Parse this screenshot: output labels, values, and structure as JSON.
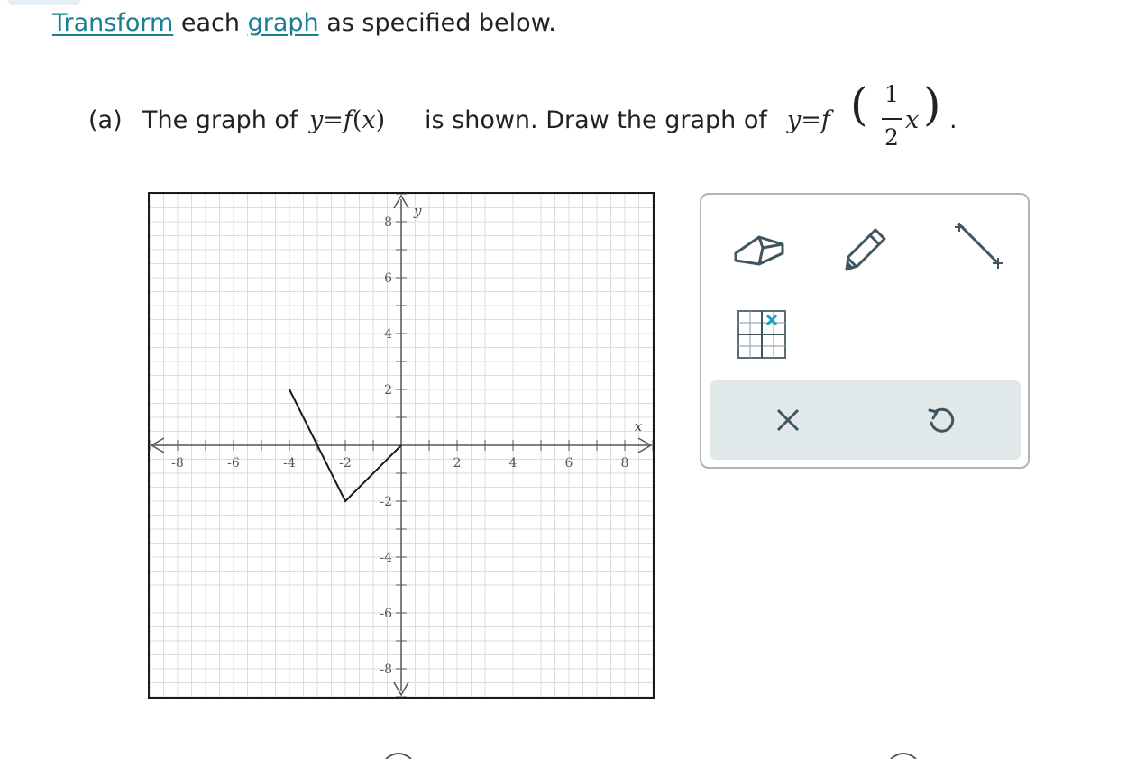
{
  "instruction": {
    "link1": "Transform",
    "middle": " each ",
    "link2": "graph",
    "rest": " as specified below."
  },
  "question": {
    "label": "(a)",
    "text1": "The graph of",
    "given_function": "y=f(x)",
    "text2": "is shown. Draw the graph of",
    "target_function": "y=f(1/2 x)",
    "frac_num": "1",
    "frac_den": "2",
    "frac_var": "x",
    "period": "."
  },
  "graph": {
    "x_axis_label": "x",
    "y_axis_label": "y",
    "x_tick_labels": [
      "-8",
      "-6",
      "-4",
      "-2",
      "2",
      "4",
      "6",
      "8"
    ],
    "y_tick_labels": [
      "8",
      "6",
      "4",
      "2",
      "-2",
      "-4",
      "-6",
      "-8"
    ],
    "x_range": [
      -9,
      9
    ],
    "y_range": [
      -9,
      9
    ],
    "grid": true,
    "given_polyline": [
      [
        -4,
        2
      ],
      [
        -2,
        -2
      ],
      [
        0,
        0
      ]
    ]
  },
  "tools": {
    "eraser": "eraser-icon",
    "pencil": "pencil-icon",
    "segment": "line-segment-icon",
    "point_grid": "point-grid-icon",
    "clear": "close-icon",
    "undo": "undo-icon"
  },
  "colors": {
    "link": "#1a7f94",
    "tool_stroke": "#3f5560",
    "accent": "#1ba0c2",
    "panel_border": "#a9b7bf",
    "action_bar": "#e1e8ea"
  }
}
